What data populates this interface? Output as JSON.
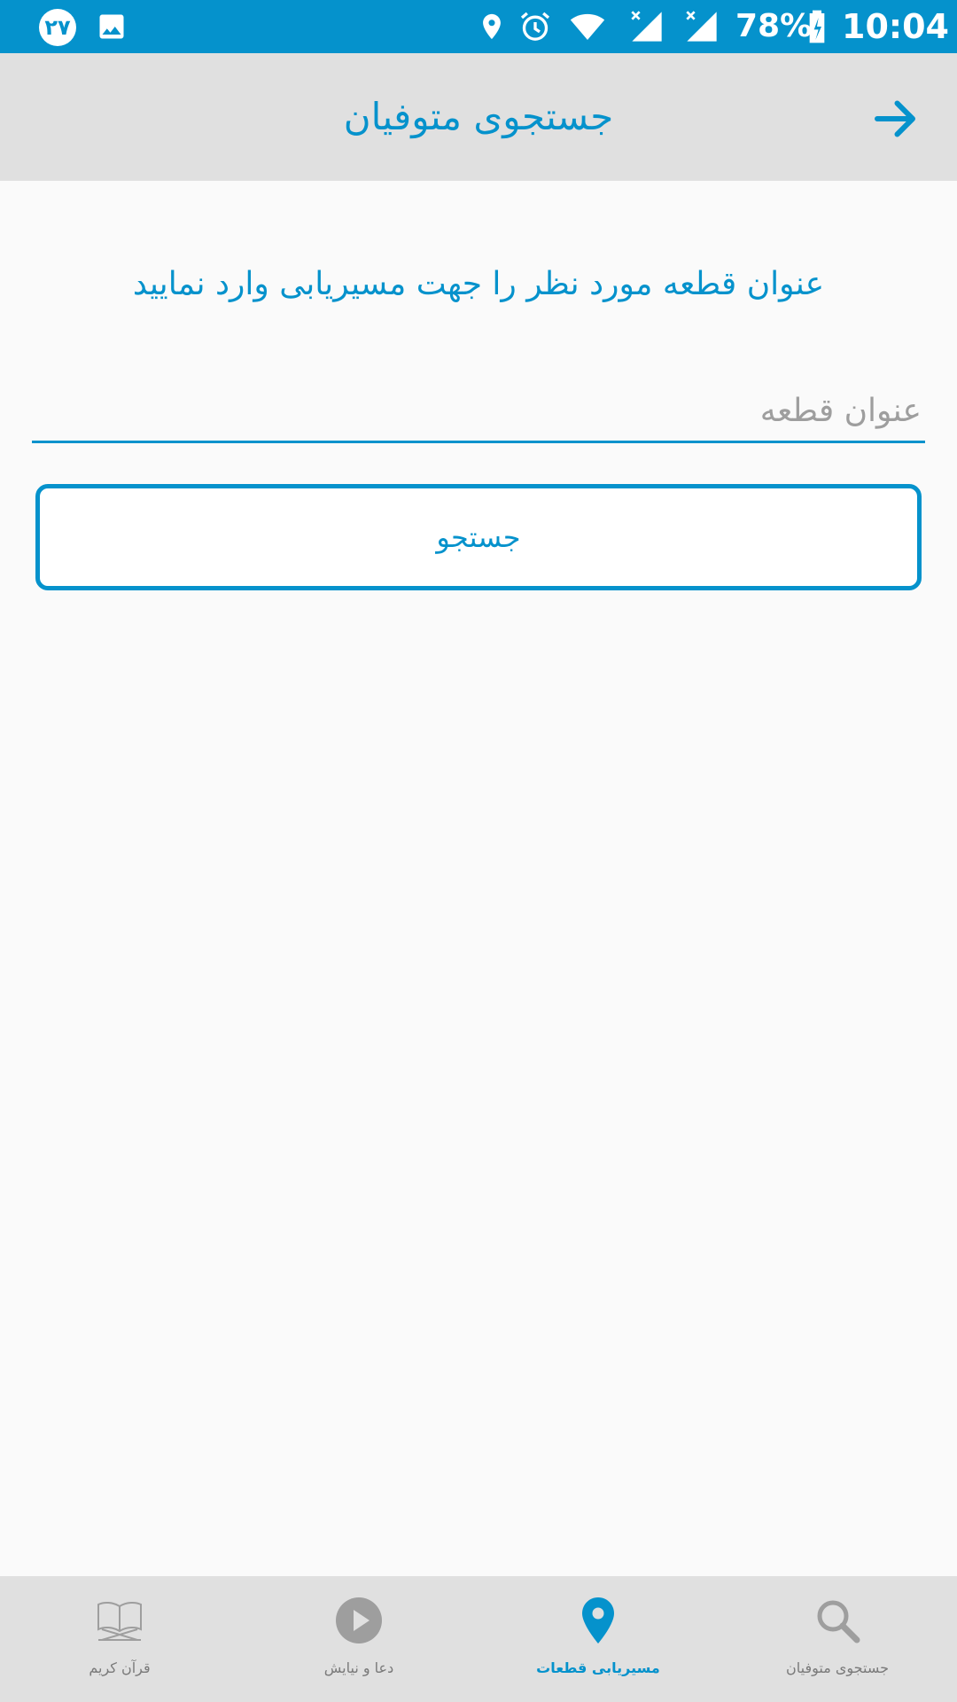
{
  "status_bar": {
    "badge": "۲۷",
    "battery": "78%",
    "time": "10:04"
  },
  "app_bar": {
    "title": "جستجوی متوفیان",
    "back_icon": "arrow-forward-icon"
  },
  "content": {
    "instruction": "عنوان قطعه مورد نظر را جهت مسیریابی وارد نمایید",
    "search_placeholder": "عنوان قطعه",
    "search_value": "",
    "search_button_label": "جستجو"
  },
  "bottom_nav": {
    "items": [
      {
        "label": "قرآن کریم",
        "icon": "quran-book-icon",
        "active": false
      },
      {
        "label": "دعا و نیایش",
        "icon": "play-circle-icon",
        "active": false
      },
      {
        "label": "مسیریابی قطعات",
        "icon": "location-pin-icon",
        "active": true
      },
      {
        "label": "جستجوی متوفیان",
        "icon": "search-icon",
        "active": false
      }
    ]
  },
  "colors": {
    "accent": "#0592cc",
    "bar_background": "#e0e0e0",
    "page_background": "#fafafa",
    "inactive": "#9e9e9e"
  }
}
